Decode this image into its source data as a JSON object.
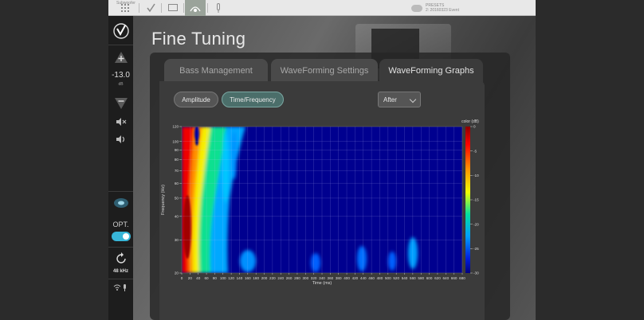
{
  "topbar": {
    "left_label": "Subwoofer",
    "right_line1": "PRESETS",
    "right_line2": "2: 20160323 Event"
  },
  "sidebar": {
    "volume": "-13.0",
    "volume_unit": "dB",
    "opt_label": "OPT.",
    "sample_rate": "48 kHz"
  },
  "page": {
    "title": "Fine Tuning"
  },
  "tabs": [
    {
      "label": "Bass Management",
      "active": false
    },
    {
      "label": "WaveForming Settings",
      "active": false
    },
    {
      "label": "WaveForming Graphs",
      "active": true
    }
  ],
  "controls": {
    "amplitude_label": "Amplitude",
    "time_freq_label": "Time/Frequency",
    "select_value": "After"
  },
  "chart_data": {
    "type": "heatmap",
    "xlabel": "Time (ms)",
    "ylabel": "Frequency (Hz)",
    "colorbar_label": "color (dB)",
    "xlim": [
      0,
      680
    ],
    "ylim": [
      20,
      120
    ],
    "x_ticks": [
      0,
      20,
      40,
      60,
      80,
      100,
      120,
      140,
      160,
      180,
      200,
      220,
      240,
      260,
      280,
      300,
      320,
      340,
      360,
      380,
      400,
      420,
      440,
      460,
      480,
      500,
      520,
      540,
      560,
      580,
      600,
      620,
      640,
      660,
      680
    ],
    "y_ticks": [
      20,
      30,
      40,
      50,
      60,
      70,
      80,
      90,
      100,
      120
    ],
    "colorbar_ticks": [
      0,
      -5,
      -10,
      -15,
      -20,
      -25,
      -30
    ],
    "colorbar_range": [
      -30,
      0
    ]
  }
}
